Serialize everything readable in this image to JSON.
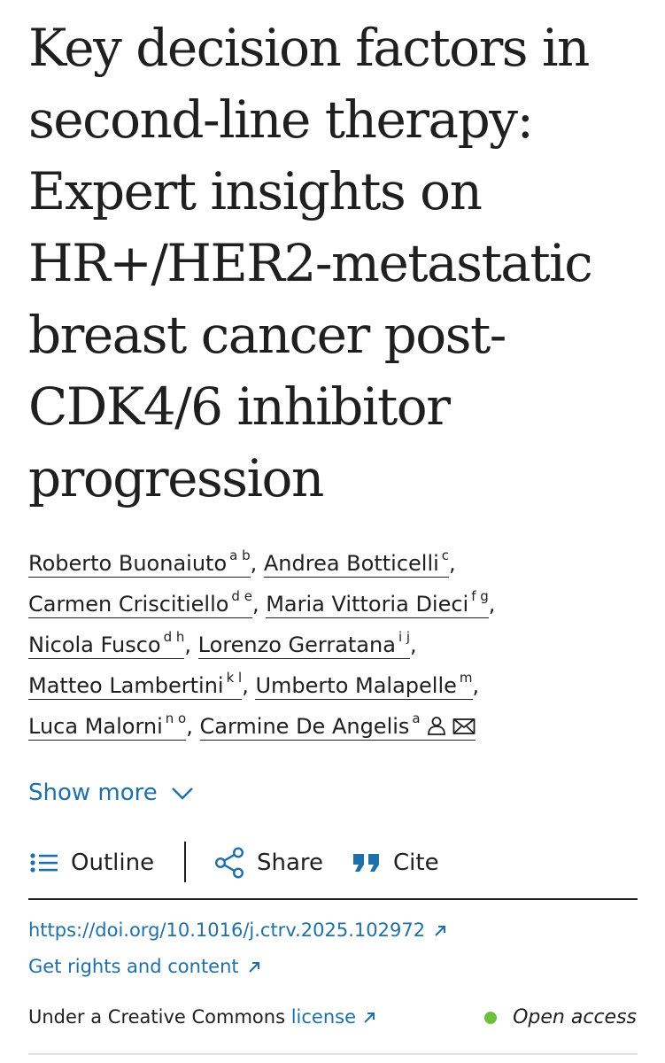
{
  "article": {
    "title_lines": [
      "Key decision factors in",
      "second-line therapy:",
      "Expert insights on",
      "HR+/HER2-metastatic",
      "breast cancer post-",
      "CDK4/6 inhibitor",
      "progression"
    ]
  },
  "authors": [
    {
      "name": "Roberto Buonaiuto",
      "aff": "a b"
    },
    {
      "name": "Andrea Botticelli",
      "aff": "c"
    },
    {
      "name": "Carmen Criscitiello",
      "aff": "d e"
    },
    {
      "name": "Maria Vittoria Dieci",
      "aff": "f g"
    },
    {
      "name": "Nicola Fusco",
      "aff": "d h"
    },
    {
      "name": "Lorenzo Gerratana",
      "aff": "i j"
    },
    {
      "name": "Matteo Lambertini",
      "aff": "k l"
    },
    {
      "name": "Umberto Malapelle",
      "aff": "m"
    },
    {
      "name": "Luca Malorni",
      "aff": "n o"
    },
    {
      "name": "Carmine De Angelis",
      "aff": "a"
    }
  ],
  "author_icons": [
    "person-icon",
    "mail-icon"
  ],
  "show_more": {
    "label": "Show more"
  },
  "toolbar": {
    "outline": "Outline",
    "share": "Share",
    "cite": "Cite"
  },
  "links": {
    "doi": "https://doi.org/10.1016/j.ctrv.2025.102972",
    "rights": "Get rights and content"
  },
  "license": {
    "prefix": "Under a Creative Commons",
    "link": "license"
  },
  "access": {
    "label": "Open access"
  },
  "colors": {
    "link": "#1f6fa8",
    "text": "#1f1f1f",
    "open_access_dot": "#6fbf3f"
  }
}
